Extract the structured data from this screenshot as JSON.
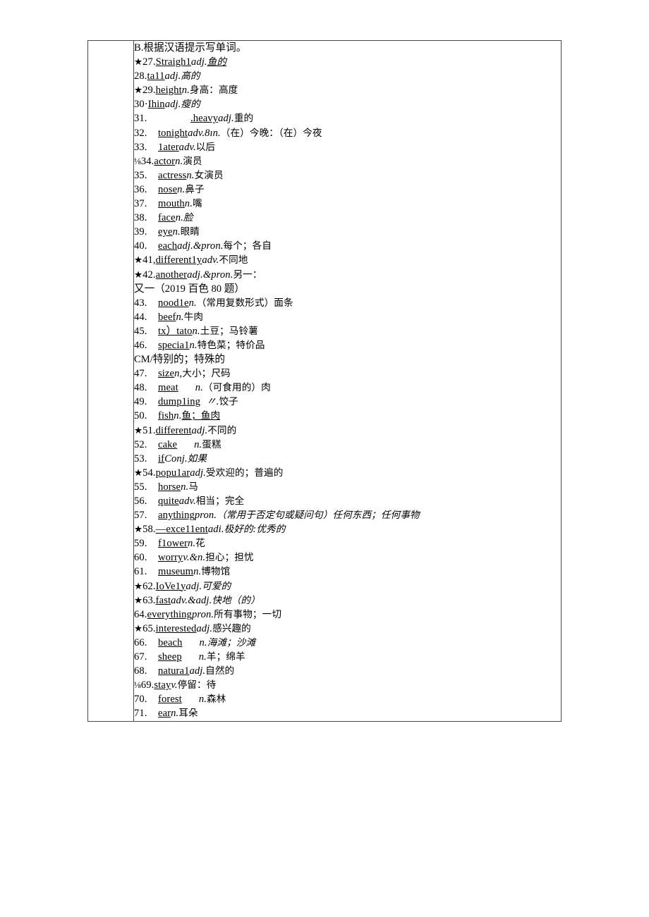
{
  "document": {
    "section_heading": "B.根据汉语提示写单词。",
    "source_note": "又一（2019 百色 80 题）",
    "continuation_note": "CM/特别的；特殊的",
    "star_marker": "★",
    "fraction_marker": "⅛",
    "entries": [
      {
        "marker": "star",
        "num": "27.",
        "word": "Straigh1",
        "pos": "adj.",
        "gloss": "鱼的",
        "gloss_style": "italic-underline",
        "layout": "inline"
      },
      {
        "marker": "none",
        "num": "28.",
        "word": "ta11",
        "pos": "adj.",
        "gloss": "高的",
        "gloss_style": "italic",
        "layout": "inline"
      },
      {
        "marker": "star",
        "num": "29.",
        "word": "height",
        "pos": "n.",
        "gloss": "身高：高度",
        "gloss_style": "plain",
        "layout": "inline"
      },
      {
        "marker": "none",
        "num": "30·",
        "word": "Ihin",
        "pos": "adj.",
        "gloss": "瘦的",
        "gloss_style": "italic",
        "layout": "inline"
      },
      {
        "marker": "none",
        "num": "31.",
        "word": ".heavy",
        "pos": "adj.",
        "gloss": "重的",
        "gloss_style": "plain",
        "layout": "tabbed-wide"
      },
      {
        "marker": "none",
        "num": "32.",
        "word": "tonight",
        "pos": "adv.8ın.",
        "gloss": "（在）今晚：（在）今夜",
        "gloss_style": "plain",
        "layout": "tabbed"
      },
      {
        "marker": "none",
        "num": "33.",
        "word": "1ater",
        "pos": "adv.",
        "gloss": "以后",
        "gloss_style": "plain",
        "layout": "tabbed"
      },
      {
        "marker": "frac",
        "num": "34.",
        "word": "actor",
        "pos": "n.",
        "gloss": "演员",
        "gloss_style": "plain",
        "layout": "inline"
      },
      {
        "marker": "none",
        "num": "35.",
        "word": "actress",
        "pos": "n.",
        "gloss": "女演员",
        "gloss_style": "plain",
        "layout": "tabbed"
      },
      {
        "marker": "none",
        "num": "36.",
        "word": "nose",
        "pos": "n.",
        "gloss": "鼻子",
        "gloss_style": "plain",
        "layout": "tabbed"
      },
      {
        "marker": "none",
        "num": "37.",
        "word": "mouth",
        "pos": "n.",
        "gloss": "嘴",
        "gloss_style": "plain",
        "layout": "tabbed"
      },
      {
        "marker": "none",
        "num": "38.",
        "word": "face",
        "pos": "n.",
        "gloss": "脸",
        "gloss_style": "italic",
        "layout": "tabbed"
      },
      {
        "marker": "none",
        "num": "39.",
        "word": "eye",
        "pos": "n.",
        "gloss": "眼睛",
        "gloss_style": "plain",
        "layout": "tabbed"
      },
      {
        "marker": "none",
        "num": "40.",
        "word": "each",
        "pos": "adj.&pron.",
        "gloss": "每个；各自",
        "gloss_style": "plain",
        "layout": "tabbed"
      },
      {
        "marker": "star",
        "num": "41,",
        "word": "different1y",
        "pos": "adv.",
        "gloss": "不同地",
        "gloss_style": "plain",
        "layout": "inline"
      },
      {
        "marker": "star",
        "num": "42.",
        "word": "another",
        "pos": "adj.&pron.",
        "gloss": "另一：",
        "gloss_style": "plain",
        "layout": "inline"
      },
      {
        "marker": "none",
        "num": "43.",
        "word": "nood1e",
        "pos": "n.",
        "gloss": "（常用复数形式）面条",
        "gloss_style": "plain",
        "layout": "tabbed"
      },
      {
        "marker": "none",
        "num": "44.",
        "word": "beef",
        "pos": "n.",
        "gloss": "牛肉",
        "gloss_style": "plain",
        "layout": "tabbed"
      },
      {
        "marker": "none",
        "num": "45.",
        "word": "tx）tato",
        "pos": "n.",
        "gloss": "土豆；马铃薯",
        "gloss_style": "plain",
        "layout": "tabbed"
      },
      {
        "marker": "none",
        "num": "46.",
        "word": "specia1",
        "pos": "n.",
        "gloss": "特色菜；特价品",
        "gloss_style": "plain",
        "layout": "tabbed"
      },
      {
        "marker": "none",
        "num": "47.",
        "word": "size",
        "pos": "n,",
        "gloss": "大小；尺码",
        "gloss_style": "plain",
        "layout": "tabbed"
      },
      {
        "marker": "none",
        "num": "48.",
        "word": "meat",
        "pos": "n.",
        "gloss": "（可食用的）肉",
        "gloss_style": "plain",
        "layout": "tabbed-gap"
      },
      {
        "marker": "none",
        "num": "49.",
        "word": "dump1ing",
        "pos": "〃.",
        "gloss": "饺子",
        "gloss_style": "plain",
        "layout": "tabbed-gap-sm"
      },
      {
        "marker": "none",
        "num": "50.",
        "word": "fish",
        "pos": "n.",
        "gloss": "鱼；鱼肉",
        "gloss_style": "underline",
        "layout": "tabbed"
      },
      {
        "marker": "star",
        "num": "51.",
        "word": "different",
        "pos": "adj.",
        "gloss": "不同的",
        "gloss_style": "plain",
        "layout": "inline"
      },
      {
        "marker": "none",
        "num": "52.",
        "word": "cake",
        "pos": "n.",
        "gloss": "蛋糕",
        "gloss_style": "plain",
        "layout": "tabbed-gap"
      },
      {
        "marker": "none",
        "num": "53.",
        "word": "if",
        "pos": "Conj.",
        "gloss": "如果",
        "gloss_style": "italic",
        "layout": "tabbed"
      },
      {
        "marker": "star",
        "num": "54.",
        "word": "popu1ar",
        "pos": "adj.",
        "gloss": "受欢迎的；普遍的",
        "gloss_style": "plain",
        "layout": "inline"
      },
      {
        "marker": "none",
        "num": "55.",
        "word": "horse",
        "pos": "n.",
        "gloss": "马",
        "gloss_style": "plain",
        "layout": "tabbed"
      },
      {
        "marker": "none",
        "num": "56.",
        "word": "quite",
        "pos": "adv.",
        "gloss": "相当；完全",
        "gloss_style": "plain",
        "layout": "tabbed"
      },
      {
        "marker": "none",
        "num": "57.",
        "word": "anything",
        "pos": "pron.",
        "gloss": "（常用于否定句或疑问句）任何东西；任何事物",
        "gloss_style": "mixed-italic",
        "layout": "tabbed"
      },
      {
        "marker": "star",
        "num": "58.",
        "word": "—exce11ent",
        "pos": "adi.",
        "gloss": "极好的:优秀的",
        "gloss_style": "italic",
        "layout": "inline"
      },
      {
        "marker": "none",
        "num": "59.",
        "word": "f1ower",
        "pos": "n.",
        "gloss": "花",
        "gloss_style": "plain",
        "layout": "tabbed"
      },
      {
        "marker": "none",
        "num": "60.",
        "word": "worry",
        "pos": "v.&n.",
        "gloss": "担心；担忧",
        "gloss_style": "plain",
        "layout": "tabbed"
      },
      {
        "marker": "none",
        "num": "61.",
        "word": "museum",
        "pos": "n.",
        "gloss": "博物馆",
        "gloss_style": "plain",
        "layout": "tabbed"
      },
      {
        "marker": "star",
        "num": "62.",
        "word": "IoVe1y",
        "pos": "adj.",
        "gloss": "可爱的",
        "gloss_style": "italic",
        "layout": "inline"
      },
      {
        "marker": "star",
        "num": "63.",
        "word": "fast",
        "pos": "adv.&adj.",
        "gloss": "快地（的）",
        "gloss_style": "italic-partial",
        "layout": "inline"
      },
      {
        "marker": "none",
        "num": "64.",
        "word": "everything",
        "pos": "pron.",
        "gloss": "所有事物；一切",
        "gloss_style": "plain",
        "layout": "inline"
      },
      {
        "marker": "star",
        "num": "65.",
        "word": "interested",
        "pos": "adj.",
        "gloss": "感兴趣的",
        "gloss_style": "plain",
        "layout": "inline"
      },
      {
        "marker": "none",
        "num": "66.",
        "word": "beach",
        "pos": "n.",
        "gloss": "海滩；沙滩",
        "gloss_style": "italic-partial",
        "layout": "tabbed-gap"
      },
      {
        "marker": "none",
        "num": "67.",
        "word": "sheep",
        "pos": "n.",
        "gloss": "羊；绵羊",
        "gloss_style": "plain",
        "layout": "tabbed-gap"
      },
      {
        "marker": "none",
        "num": "68.",
        "word": "natura1",
        "pos": "adj.",
        "gloss": "自然的",
        "gloss_style": "plain",
        "layout": "tabbed"
      },
      {
        "marker": "frac",
        "num": "69.",
        "word": "stay",
        "pos": "v.",
        "gloss": "停留：待",
        "gloss_style": "plain",
        "layout": "inline"
      },
      {
        "marker": "none",
        "num": "70.",
        "word": "forest",
        "pos": "n.",
        "gloss": "森林",
        "gloss_style": "plain",
        "layout": "tabbed-gap"
      },
      {
        "marker": "none",
        "num": "71.",
        "word": "ear",
        "pos": "n.",
        "gloss": "耳朵",
        "gloss_style": "plain",
        "layout": "tabbed"
      }
    ]
  }
}
